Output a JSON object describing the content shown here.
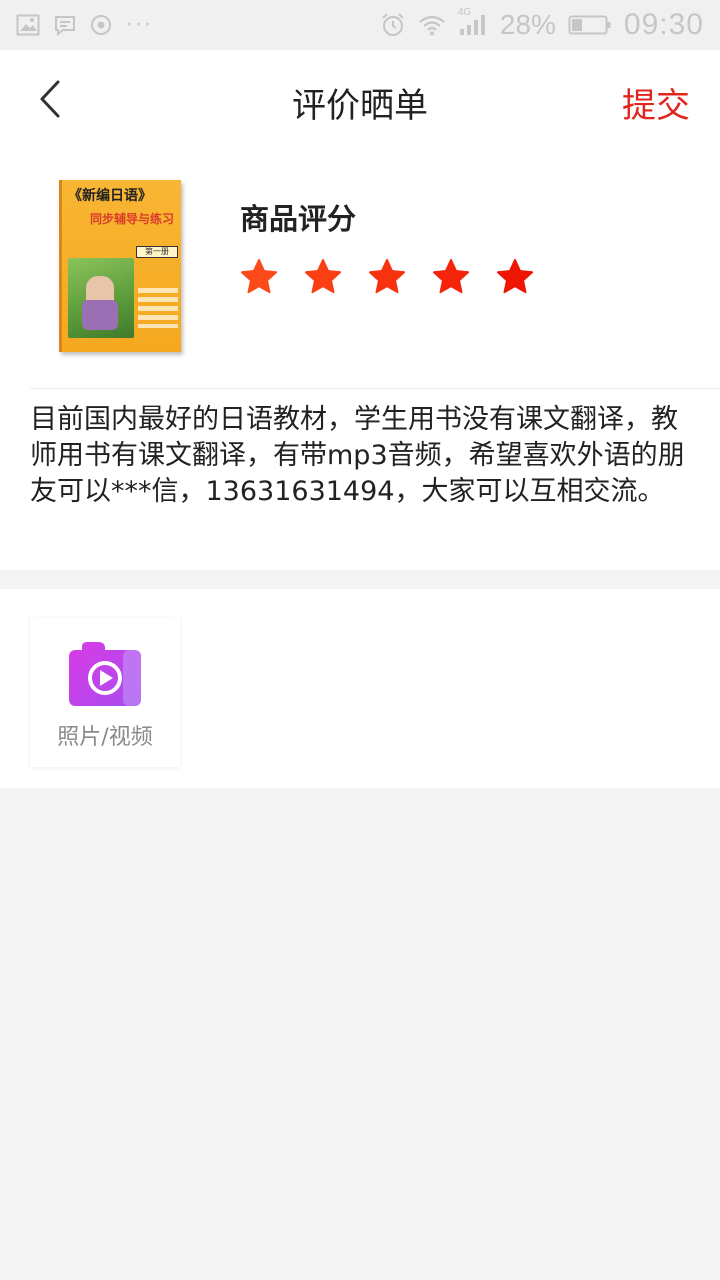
{
  "status_bar": {
    "battery": "28%",
    "time": "09:30",
    "network": "4G",
    "more": "···",
    "icons": [
      "image-icon",
      "message-icon",
      "location-icon",
      "alarm-icon",
      "wifi-icon",
      "signal-icon",
      "battery-icon"
    ]
  },
  "header": {
    "title": "评价晒单",
    "submit": "提交",
    "back_icon": "chevron-left-icon"
  },
  "product": {
    "cover": {
      "title": "《新编日语》",
      "subtitle": "同步辅导与练习",
      "badge": "第一册"
    },
    "rating_label": "商品评分",
    "rating": {
      "value": 5,
      "max": 5
    },
    "star_colors": [
      "#fd4a1a",
      "#fb3e14",
      "#f8320f",
      "#f4250a",
      "#ef1505"
    ]
  },
  "review": {
    "text": "目前国内最好的日语教材，学生用书没有课文翻译，教师用书有课文翻译，有带mp3音频，希望喜欢外语的朋友可以***信，13631631494，大家可以互相交流。"
  },
  "media": {
    "label": "照片/视频",
    "icon": "camera-video-icon"
  },
  "colors": {
    "accent": "#e0251f",
    "page_bg": "#f4f4f4"
  }
}
